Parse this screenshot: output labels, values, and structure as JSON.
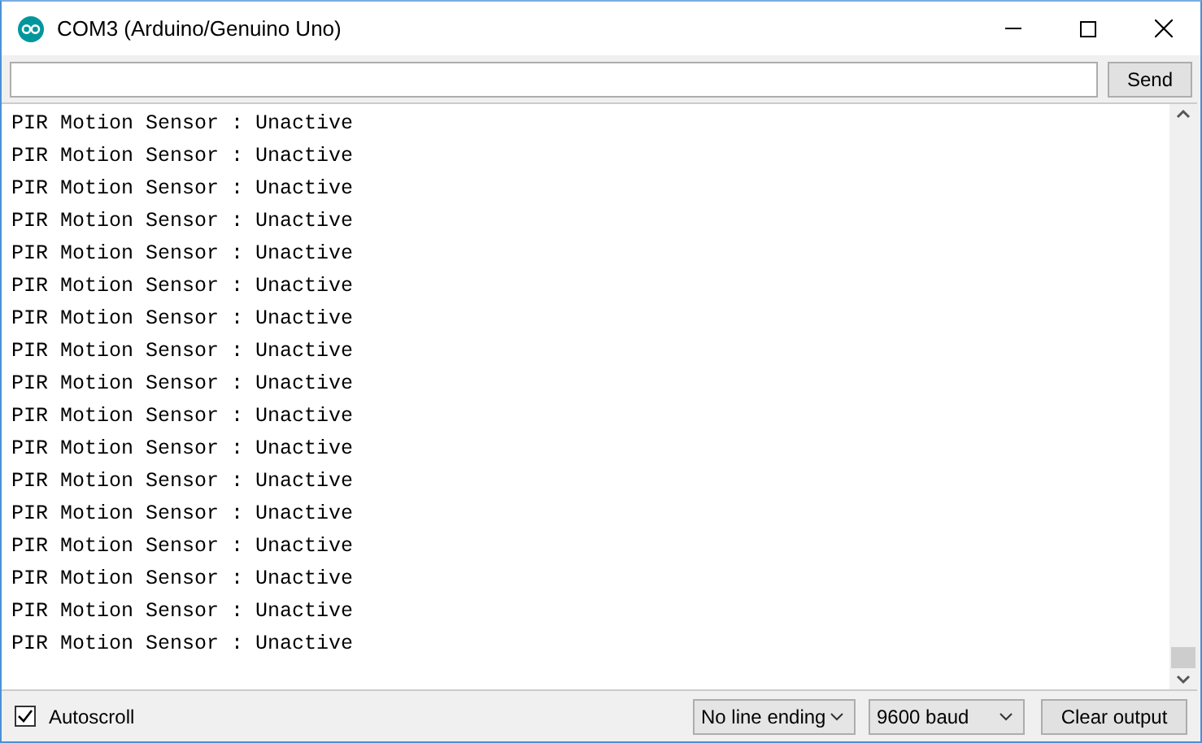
{
  "window": {
    "title": "COM3 (Arduino/Genuino Uno)"
  },
  "send": {
    "button": "Send"
  },
  "output": [
    "PIR Motion Sensor : Unactive",
    "PIR Motion Sensor : Unactive",
    "PIR Motion Sensor : Unactive",
    "PIR Motion Sensor : Unactive",
    "PIR Motion Sensor : Unactive",
    "PIR Motion Sensor : Unactive",
    "PIR Motion Sensor : Unactive",
    "PIR Motion Sensor : Unactive",
    "PIR Motion Sensor : Unactive",
    "PIR Motion Sensor : Unactive",
    "PIR Motion Sensor : Unactive",
    "PIR Motion Sensor : Unactive",
    "PIR Motion Sensor : Unactive",
    "PIR Motion Sensor : Unactive",
    "PIR Motion Sensor : Unactive",
    "PIR Motion Sensor : Unactive",
    "PIR Motion Sensor : Unactive"
  ],
  "bottom": {
    "autoscroll": {
      "label": "Autoscroll",
      "checked": true
    },
    "line_ending": "No line ending",
    "baud": "9600 baud",
    "clear_button": "Clear output"
  }
}
